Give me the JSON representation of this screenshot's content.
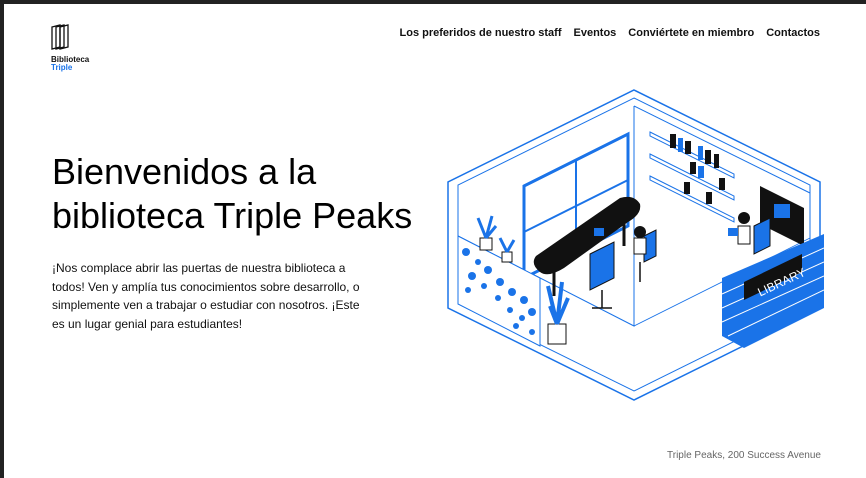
{
  "brand": {
    "name_line1": "Biblioteca",
    "name_line2": "Triple",
    "accent_color": "#1a73e8",
    "logo_icon": "triple-panels-icon"
  },
  "nav": {
    "items": [
      {
        "label": "Los preferidos de nuestro staff"
      },
      {
        "label": "Eventos"
      },
      {
        "label": "Conviértete en miembro"
      },
      {
        "label": "Contactos"
      }
    ]
  },
  "hero": {
    "title": "Bienvenidos a la biblioteca Triple Peaks",
    "text": "¡Nos complace abrir las puertas de nuestra biblioteca a todos! Ven y amplía tus conocimientos sobre desarrollo, o simplemente ven a trabajar o estudiar con nosotros. ¡Este es un lugar genial para estudiantes!",
    "illustration_sign": "LIBRARY",
    "illustration_icon": "library-room-illustration"
  },
  "footer": {
    "address": "Triple Peaks, 200 Success Avenue"
  }
}
